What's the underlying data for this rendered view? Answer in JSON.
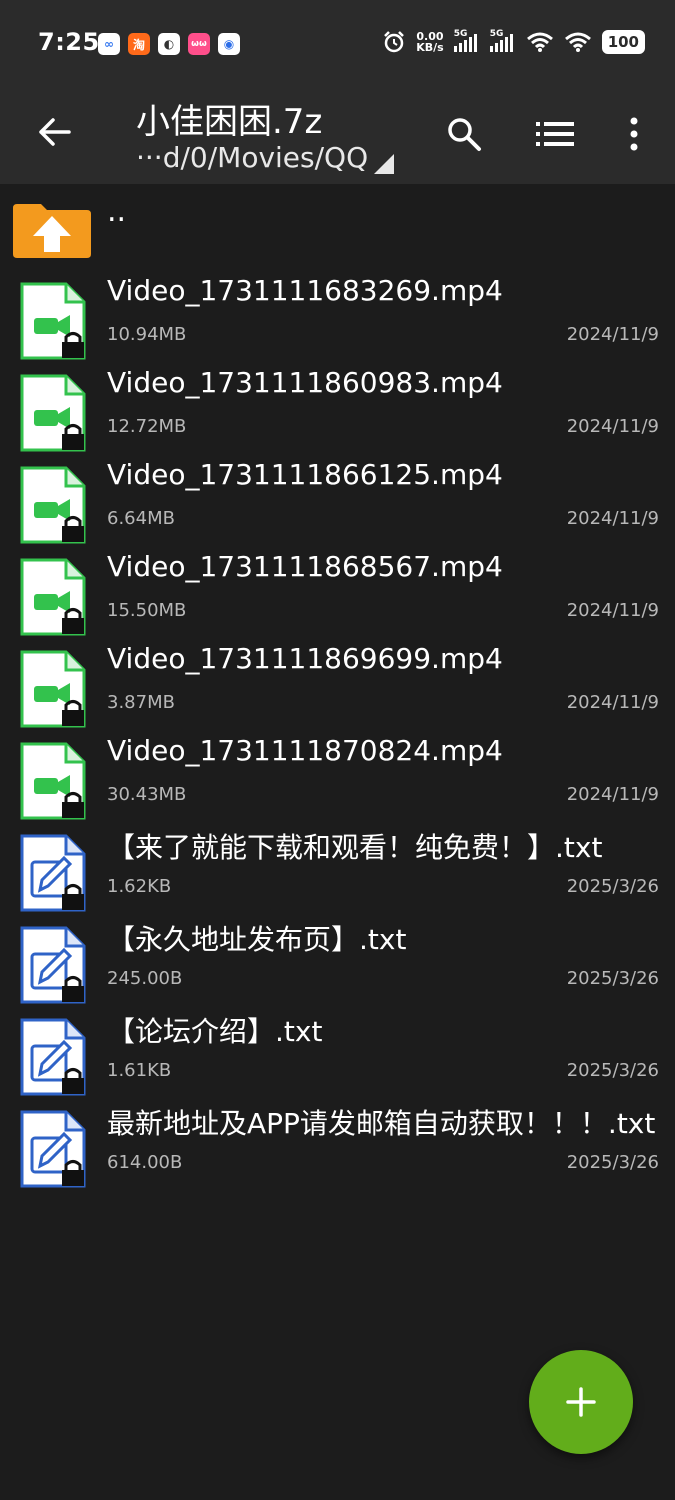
{
  "status": {
    "time": "7:25",
    "net_speed_top": "0.00",
    "net_speed_bottom": "KB/s",
    "sig1_label": "5G",
    "sig2_label": "5G",
    "battery": "100",
    "notif1": "∞",
    "notif2": "淘",
    "notif3": "◐",
    "notif4": "ωω",
    "notif5": "◉"
  },
  "appbar": {
    "title": "小佳困困.7z",
    "path": "···d/0/Movies/QQ"
  },
  "parent": {
    "label": ".."
  },
  "files": [
    {
      "name": "Video_1731111683269.mp4",
      "size": "10.94MB",
      "date": "2024/11/9",
      "type": "video"
    },
    {
      "name": "Video_1731111860983.mp4",
      "size": "12.72MB",
      "date": "2024/11/9",
      "type": "video"
    },
    {
      "name": "Video_1731111866125.mp4",
      "size": "6.64MB",
      "date": "2024/11/9",
      "type": "video"
    },
    {
      "name": "Video_1731111868567.mp4",
      "size": "15.50MB",
      "date": "2024/11/9",
      "type": "video"
    },
    {
      "name": "Video_1731111869699.mp4",
      "size": "3.87MB",
      "date": "2024/11/9",
      "type": "video"
    },
    {
      "name": "Video_1731111870824.mp4",
      "size": "30.43MB",
      "date": "2024/11/9",
      "type": "video"
    },
    {
      "name": "【来了就能下载和观看！纯免费！】.txt",
      "size": "1.62KB",
      "date": "2025/3/26",
      "type": "text"
    },
    {
      "name": "【永久地址发布页】.txt",
      "size": "245.00B",
      "date": "2025/3/26",
      "type": "text"
    },
    {
      "name": "【论坛介绍】.txt",
      "size": "1.61KB",
      "date": "2025/3/26",
      "type": "text"
    },
    {
      "name": "最新地址及APP请发邮箱自动获取！！！.txt",
      "size": "614.00B",
      "date": "2025/3/26",
      "type": "text"
    }
  ],
  "colors": {
    "video_accent": "#33c24d",
    "text_accent": "#2f63c7",
    "folder": "#f39a1e",
    "fab": "#62ad1b"
  }
}
